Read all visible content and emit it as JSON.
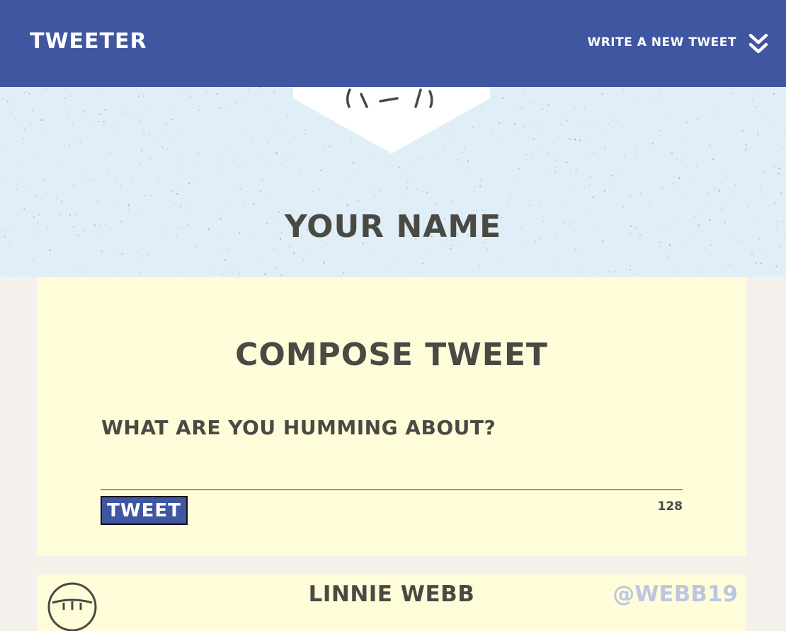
{
  "nav": {
    "brand": "TWEETER",
    "compose_link": "WRITE A NEW TWEET",
    "toggle_icon": "double-chevron-down-icon"
  },
  "hero": {
    "name": "YOUR NAME",
    "avatar_icon": "avatar-icon"
  },
  "compose": {
    "title": "COMPOSE TWEET",
    "prompt": "WHAT ARE YOU HUMMING ABOUT?",
    "input_value": "",
    "button_label": "TWEET",
    "counter": "128"
  },
  "tweets": [
    {
      "name": "LINNIE WEBB",
      "handle": "@WEBB19",
      "avatar_icon": "avatar-icon"
    }
  ],
  "colors": {
    "nav": "#4056a1",
    "hero_bg": "#e0eff7",
    "card_bg": "#fffdd9",
    "page_bg": "#f4f1ec",
    "text": "#4a4a44",
    "handle": "#bcc6e2"
  }
}
